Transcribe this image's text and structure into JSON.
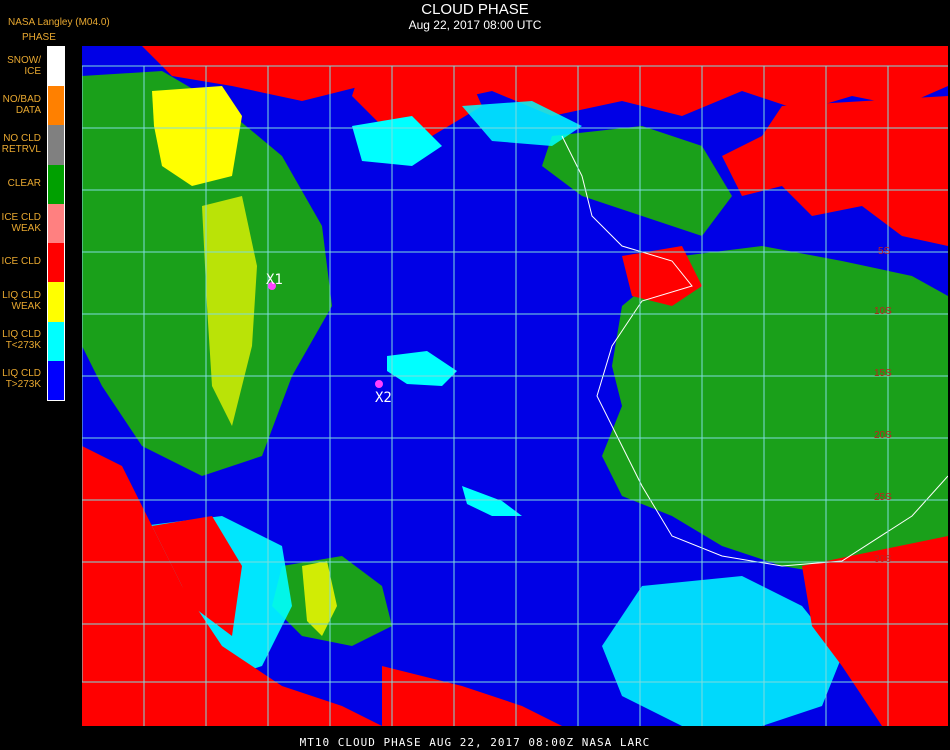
{
  "header": {
    "title": "CLOUD PHASE",
    "subtitle": "Aug 22, 2017 08:00 UTC",
    "agency": "NASA Langley (M04.0)",
    "legend_title": "PHASE"
  },
  "legend": [
    {
      "label": "SNOW/\nICE",
      "color": "#ffffff"
    },
    {
      "label": "NO/BAD\nDATA",
      "color": "#ff8000"
    },
    {
      "label": "NO CLD\nRETRVL",
      "color": "#808080"
    },
    {
      "label": "CLEAR",
      "color": "#00a000"
    },
    {
      "label": "ICE CLD\nWEAK",
      "color": "#ff8080"
    },
    {
      "label": "ICE CLD",
      "color": "#ff0000"
    },
    {
      "label": "LIQ CLD\nWEAK",
      "color": "#ffff00"
    },
    {
      "label": "LIQ CLD\nT<273K",
      "color": "#00ffff"
    },
    {
      "label": "LIQ CLD\nT>273K",
      "color": "#0000ff"
    }
  ],
  "markers": [
    {
      "label": "X1"
    },
    {
      "label": "X2"
    }
  ],
  "lat_labels": [
    "5S",
    "10S",
    "15S",
    "20S",
    "25S",
    "30S"
  ],
  "footer": "MT10  CLOUD PHASE   AUG 22, 2017 08:00Z   NASA LARC",
  "colors": {
    "grid": "#7fdcdc",
    "marker": "#ff40ff",
    "ocean": "#0000e6",
    "clear": "#1aa01a",
    "ice": "#ff0000",
    "liquid_cold": "#00ffff",
    "liquid_weak": "#ffff00"
  }
}
